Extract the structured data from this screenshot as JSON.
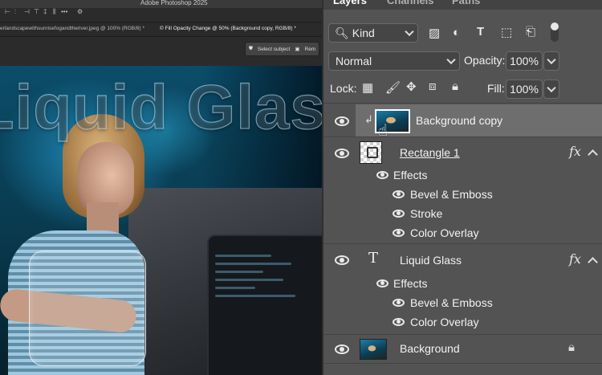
{
  "app": {
    "title": "Adobe Photoshop 2025"
  },
  "document_tabs": [
    {
      "label": "erlandscapewithsunrisefogandtheriver.jpeg @ 100% (RGB/8) *"
    },
    {
      "label": "© Fill Opacity Change @ 50% (Background copy, RGB/8) *"
    }
  ],
  "context_bar": {
    "select_subject": "Select subject",
    "remove": "Rem"
  },
  "canvas": {
    "overlay_text": "Liquid Glass"
  },
  "panel": {
    "tabs": [
      "Layers",
      "Channels",
      "Paths"
    ],
    "filter": {
      "kind_label": "Kind"
    },
    "blend_mode": "Normal",
    "opacity_label": "Opacity:",
    "opacity_value": "100%",
    "lock_label": "Lock:",
    "fill_label": "Fill:",
    "fill_value": "100%"
  },
  "layers": [
    {
      "name": "Background copy",
      "selected": true
    },
    {
      "name": "Rectangle 1",
      "effects_label": "Effects",
      "effects": [
        "Bevel & Emboss",
        "Stroke",
        "Color Overlay"
      ]
    },
    {
      "name": "Liquid Glass",
      "type_icon": "T",
      "effects_label": "Effects",
      "effects": [
        "Bevel & Emboss",
        "Color Overlay"
      ]
    },
    {
      "name": "Background",
      "locked": true
    }
  ],
  "labels": {
    "fx": "fx"
  },
  "colors": {
    "panel_bg": "#535353",
    "selected_row": "#6e6e6e",
    "canvas_blue": "#1d86b3"
  }
}
